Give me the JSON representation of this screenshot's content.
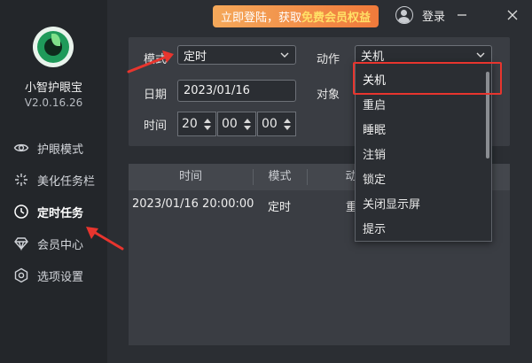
{
  "app": {
    "name": "小智护眼宝",
    "version": "V2.0.16.26"
  },
  "topbar": {
    "banner_prefix": "立即登陆，获取",
    "banner_highlight": "免费会员权益",
    "login_label": "登录",
    "icons": [
      "user-icon",
      "minimize-icon",
      "close-icon"
    ]
  },
  "sidebar": {
    "items": [
      {
        "label": "护眼模式",
        "icon": "eye-icon",
        "active": false
      },
      {
        "label": "美化任务栏",
        "icon": "sparkle-icon",
        "active": false
      },
      {
        "label": "定时任务",
        "icon": "clock-icon",
        "active": true
      },
      {
        "label": "会员中心",
        "icon": "diamond-icon",
        "active": false
      },
      {
        "label": "选项设置",
        "icon": "gear-icon",
        "active": false
      }
    ]
  },
  "form": {
    "mode_label": "模式",
    "mode_value": "定时",
    "action_label": "动作",
    "action_value": "关机",
    "date_label": "日期",
    "date_value": "2023/01/16",
    "target_label": "对象",
    "time_label": "时间",
    "hour": "20",
    "minute": "00",
    "second": "00"
  },
  "table": {
    "headers": [
      "时间",
      "模式",
      "动"
    ],
    "rows": [
      [
        "2023/01/16 20:00:00",
        "定时",
        "重"
      ]
    ]
  },
  "dropdown": {
    "options": [
      "关机",
      "重启",
      "睡眠",
      "注销",
      "锁定",
      "关闭显示屏",
      "提示"
    ],
    "selected_index": 0
  },
  "colors": {
    "sidebar_bg": "#23262a",
    "content_bg": "#2b2e33",
    "panel_bg": "#3a3d43",
    "banner_orange": "#f07a3b",
    "banner_highlight": "#ffe066",
    "annotation_red": "#e8352e"
  }
}
